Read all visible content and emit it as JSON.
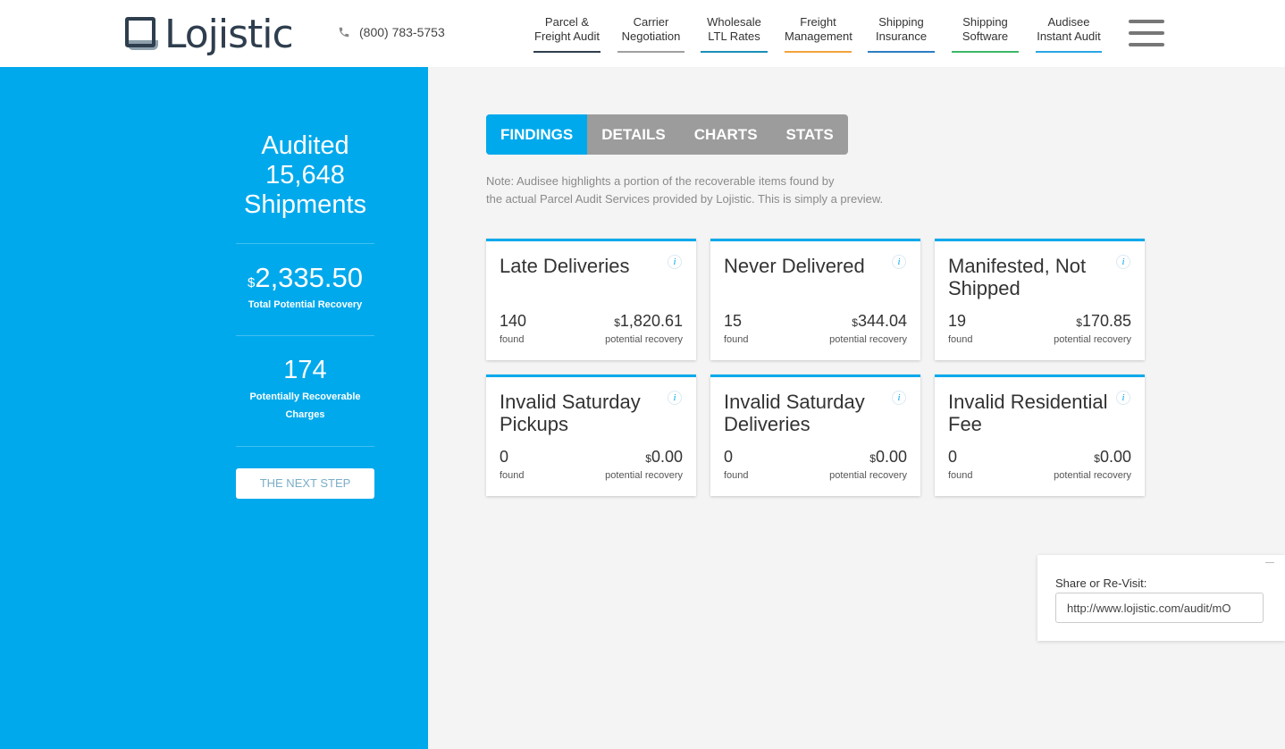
{
  "header": {
    "logo_text": "Lojistic",
    "phone": "(800) 783-5753",
    "nav": [
      {
        "line1": "Parcel &",
        "line2": "Freight Audit",
        "color": "#2f3e4e"
      },
      {
        "line1": "Carrier",
        "line2": "Negotiation",
        "color": "#a0a0a0"
      },
      {
        "line1": "Wholesale",
        "line2": "LTL Rates",
        "color": "#1a8fb8"
      },
      {
        "line1": "Freight",
        "line2": "Management",
        "color": "#f4a23b"
      },
      {
        "line1": "Shipping",
        "line2": "Insurance",
        "color": "#2b7fc1"
      },
      {
        "line1": "Shipping",
        "line2": "Software",
        "color": "#3cb868"
      },
      {
        "line1": "Audisee",
        "line2": "Instant Audit",
        "color": "#29a6e3"
      }
    ]
  },
  "sidebar": {
    "title_line1": "Audited",
    "title_line2": "15,648",
    "title_line3": "Shipments",
    "currency": "$",
    "amount": "2,335.50",
    "amount_label": "Total Potential Recovery",
    "count": "174",
    "count_label_line1": "Potentially Recoverable",
    "count_label_line2": "Charges",
    "next_button": "THE NEXT STEP"
  },
  "tabs": [
    "FINDINGS",
    "DETAILS",
    "CHARTS",
    "STATS"
  ],
  "note_line1": "Note: Audisee highlights a portion of the recoverable items found by",
  "note_line2": "the actual Parcel Audit Services provided by Lojistic. This is simply a preview.",
  "card_labels": {
    "found": "found",
    "recovery": "potential recovery",
    "currency": "$",
    "info": "i"
  },
  "cards": [
    {
      "title_line1": "Late Deliveries",
      "title_line2": "",
      "count": "140",
      "recovery": "1,820.61"
    },
    {
      "title_line1": "Never Delivered",
      "title_line2": "",
      "count": "15",
      "recovery": "344.04"
    },
    {
      "title_line1": "Manifested, Not",
      "title_line2": "Shipped",
      "count": "19",
      "recovery": "170.85"
    },
    {
      "title_line1": "Invalid Saturday",
      "title_line2": "Pickups",
      "count": "0",
      "recovery": "0.00"
    },
    {
      "title_line1": "Invalid Saturday",
      "title_line2": "Deliveries",
      "count": "0",
      "recovery": "0.00"
    },
    {
      "title_line1": "Invalid Residential",
      "title_line2": "Fee",
      "count": "0",
      "recovery": "0.00"
    }
  ],
  "share": {
    "label": "Share or Re-Visit:",
    "url": "http://www.lojistic.com/audit/mO"
  },
  "colors": {
    "accent": "#00a9ec",
    "tab_inactive": "#9c9c9c"
  }
}
